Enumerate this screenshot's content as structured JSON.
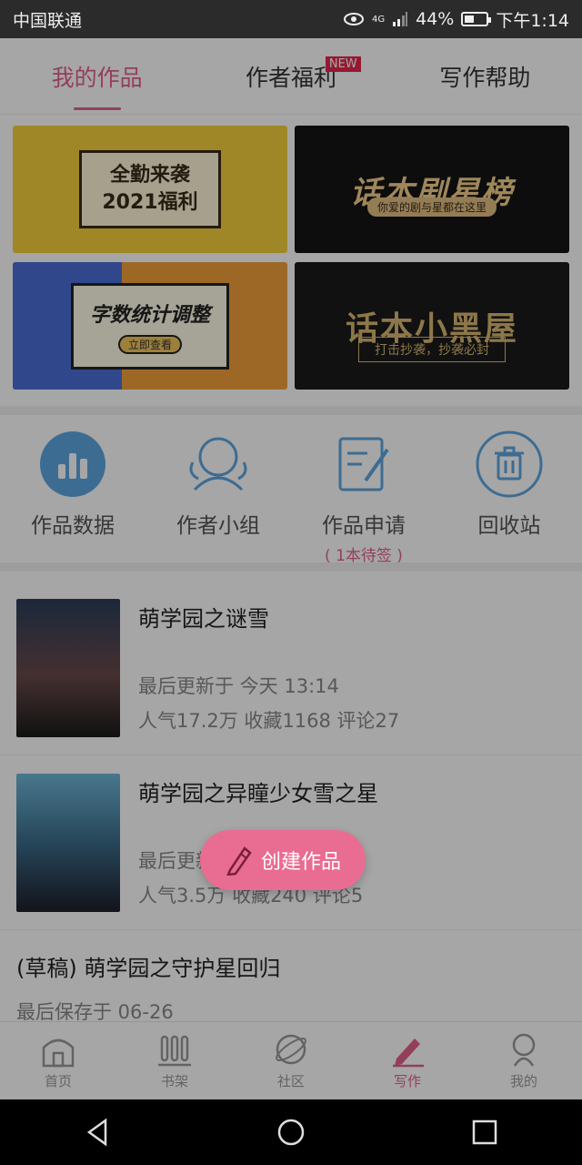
{
  "status_bar": {
    "carrier": "中国联通",
    "network": "4G",
    "battery": "44%",
    "battery_level": 0.44,
    "time": "下午1:14"
  },
  "tabs": [
    {
      "label": "我的作品",
      "active": true
    },
    {
      "label": "作者福利",
      "badge": "NEW"
    },
    {
      "label": "写作帮助"
    }
  ],
  "banners": [
    {
      "line1": "全勤来袭",
      "line2": "2021福利"
    },
    {
      "title": "话本剧星榜",
      "subtitle": "你爱的剧与星都在这里"
    },
    {
      "title": "字数统计调整",
      "button": "立即查看"
    },
    {
      "title": "话本小黑屋",
      "subtitle": "打击抄袭，抄袭必封"
    }
  ],
  "features": [
    {
      "label": "作品数据",
      "icon": "bar-chart-icon"
    },
    {
      "label": "作者小组",
      "icon": "group-icon"
    },
    {
      "label": "作品申请",
      "sub": "( 1本待签 )",
      "icon": "edit-doc-icon"
    },
    {
      "label": "回收站",
      "icon": "trash-icon"
    }
  ],
  "works": [
    {
      "title": "萌学园之谜雪",
      "updated": "最后更新于 今天 13:14",
      "stats": "人气17.2万 收藏1168 评论27"
    },
    {
      "title": "萌学园之异瞳少女雪之星",
      "updated": "最后更新于",
      "stats": "人气3.5万 收藏240 评论5"
    },
    {
      "title": "(草稿) 萌学园之守护星回归",
      "updated": "最后保存于 06-26"
    }
  ],
  "fab": {
    "label": "创建作品"
  },
  "bottom_nav": [
    {
      "label": "首页",
      "icon": "home-icon"
    },
    {
      "label": "书架",
      "icon": "bookshelf-icon"
    },
    {
      "label": "社区",
      "icon": "planet-icon"
    },
    {
      "label": "写作",
      "icon": "pen-icon",
      "active": true
    },
    {
      "label": "我的",
      "icon": "profile-icon"
    }
  ],
  "colors": {
    "accent": "#e36289",
    "fab": "#e96c92",
    "new_badge": "#e5274d"
  }
}
